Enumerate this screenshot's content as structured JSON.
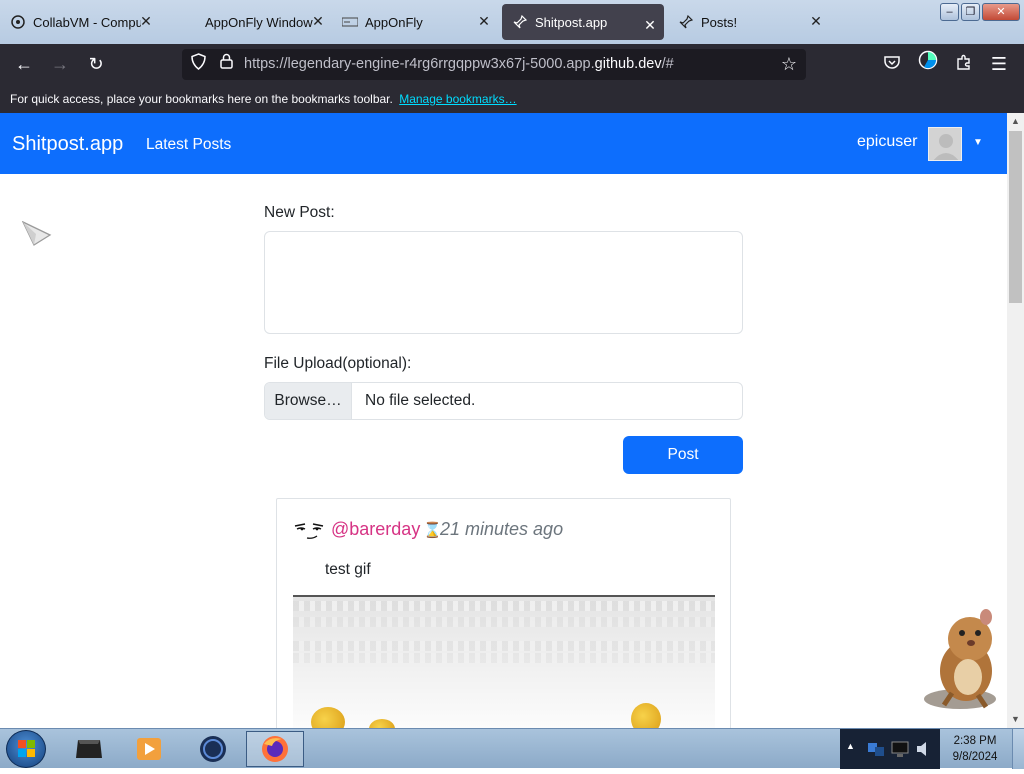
{
  "tabs": [
    {
      "title": "CollabVM - Comput",
      "icon": "collabvm-icon"
    },
    {
      "title": "AppOnFly Windows",
      "icon": ""
    },
    {
      "title": "AppOnFly",
      "icon": "apponfly-icon"
    },
    {
      "title": "Shitpost.app",
      "icon": "pin-icon",
      "active": true
    },
    {
      "title": "Posts!",
      "icon": "pin-icon"
    }
  ],
  "address_bar": {
    "url_prefix": "https://legendary-engine-r4rg6rrgqppw3x67j-5000.app.",
    "url_domain": "github.dev",
    "url_suffix": "/#"
  },
  "bookmarks_bar": {
    "message": "For quick access, place your bookmarks here on the bookmarks toolbar.",
    "link": "Manage bookmarks…"
  },
  "site_nav": {
    "brand": "Shitpost.app",
    "latest_posts": "Latest Posts",
    "username": "epicuser"
  },
  "form": {
    "new_post_label": "New Post:",
    "new_post_value": "",
    "file_upload_label": "File Upload(optional):",
    "browse_button": "Browse…",
    "file_status": "No file selected.",
    "post_button": "Post"
  },
  "post": {
    "author": "@barerday",
    "time": "21 minutes ago",
    "text": "test gif"
  },
  "taskbar": {
    "clock_time": "2:38 PM",
    "clock_date": "9/8/2024"
  },
  "colors": {
    "primary": "#0d6efd",
    "handle": "#d63384",
    "muted": "#6c757d",
    "browser_chrome": "#2b2a33"
  }
}
